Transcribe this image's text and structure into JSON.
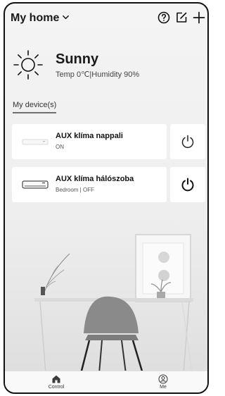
{
  "header": {
    "title": "My home",
    "icons": [
      "chevron-down-icon",
      "help-icon",
      "edit-icon",
      "add-icon"
    ]
  },
  "weather": {
    "icon": "sun-icon",
    "condition": "Sunny",
    "details": "Temp 0℃|Humidity 90%"
  },
  "section": {
    "title": "My device(s)"
  },
  "devices": [
    {
      "name": "AUX klíma nappali",
      "status": "ON",
      "icon": "air-conditioner-icon",
      "power_icon": "power-icon"
    },
    {
      "name": "AUX klíma hálószoba",
      "status": "Bedroom | OFF",
      "icon": "air-conditioner-icon",
      "power_icon": "power-icon"
    }
  ],
  "tabbar": {
    "tabs": [
      {
        "label": "Control",
        "icon": "home-icon",
        "selected": true
      },
      {
        "label": "Me",
        "icon": "user-icon",
        "selected": false
      }
    ]
  }
}
